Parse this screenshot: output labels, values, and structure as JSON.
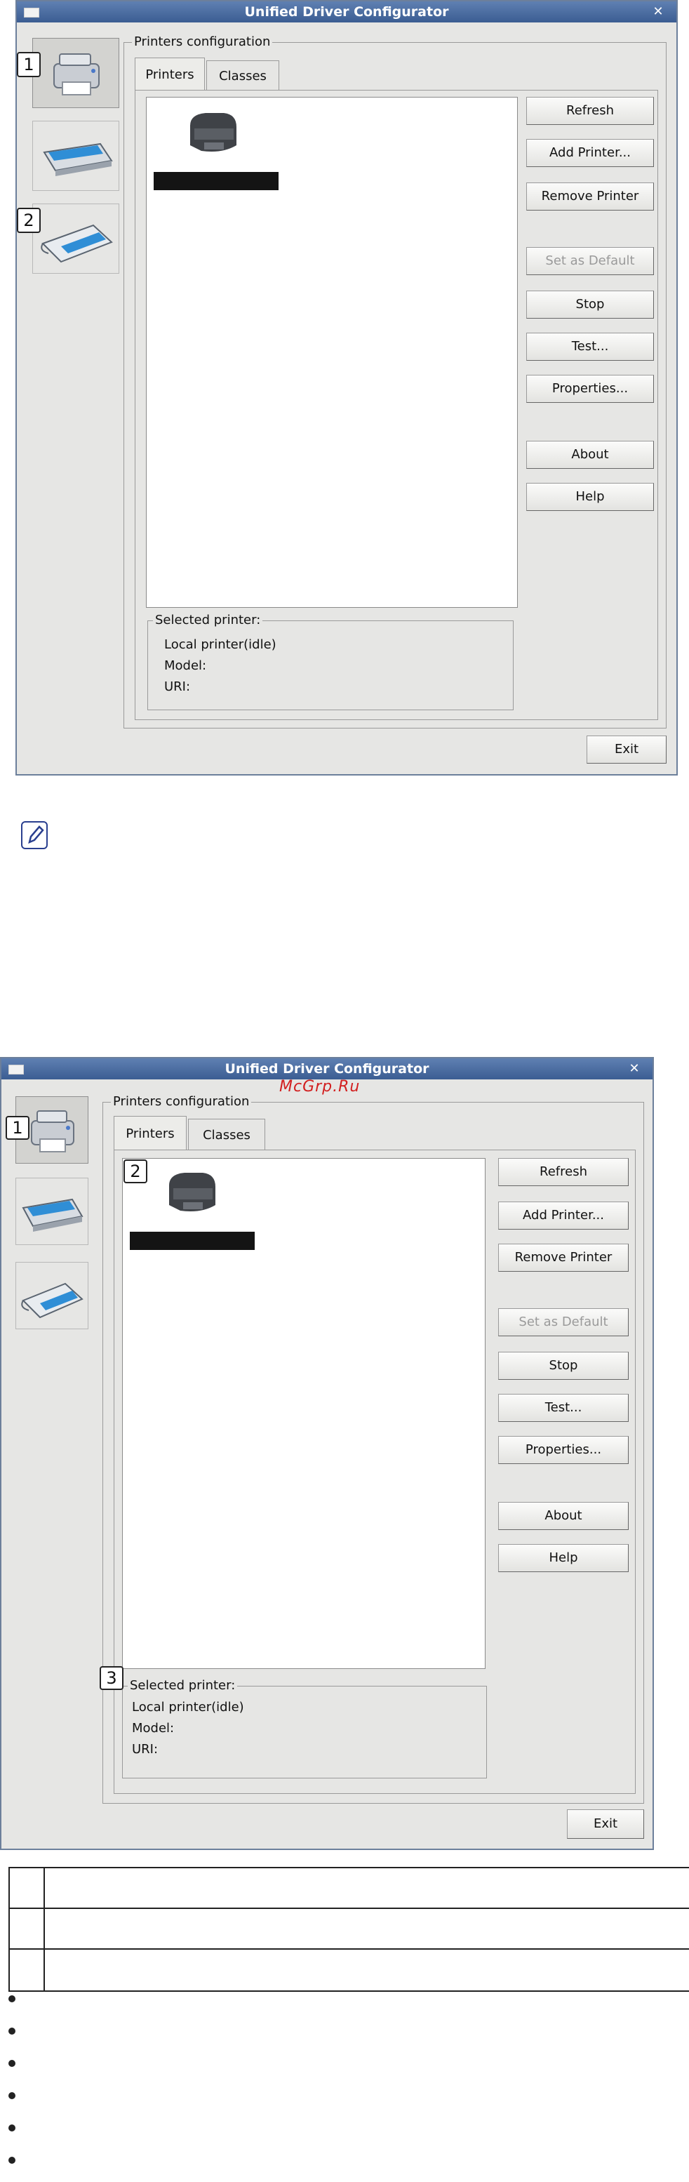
{
  "screens": [
    {
      "title": "Unified Driver Configurator",
      "close_label": "✕",
      "group_title": "Printers configuration",
      "tabs": [
        "Printers",
        "Classes"
      ],
      "buttons": {
        "refresh": "Refresh",
        "add_printer": "Add Printer...",
        "remove_printer": "Remove Printer",
        "set_default": "Set as Default",
        "stop": "Stop",
        "test": "Test...",
        "properties": "Properties...",
        "about": "About",
        "help": "Help",
        "exit": "Exit"
      },
      "selected_printer": {
        "title": "Selected printer:",
        "status": "Local printer(idle)",
        "model": "Model:",
        "uri": "URI:"
      },
      "callouts": [
        "1",
        "2"
      ]
    },
    {
      "title": "Unified Driver Configurator",
      "close_label": "✕",
      "group_title": "Printers configuration",
      "tabs": [
        "Printers",
        "Classes"
      ],
      "buttons": {
        "refresh": "Refresh",
        "add_printer": "Add Printer...",
        "remove_printer": "Remove Printer",
        "set_default": "Set as Default",
        "stop": "Stop",
        "test": "Test...",
        "properties": "Properties...",
        "about": "About",
        "help": "Help",
        "exit": "Exit"
      },
      "selected_printer": {
        "title": "Selected printer:",
        "status": "Local printer(idle)",
        "model": "Model:",
        "uri": "URI:"
      },
      "callouts": [
        "1",
        "2",
        "3"
      ],
      "watermark": "McGrp.Ru"
    }
  ],
  "icons": {
    "note": "note-pencil-icon",
    "printer": "printer-icon",
    "scanner": "scanner-icon",
    "port": "port-icon"
  },
  "colors": {
    "titlebar": "#3b5d92",
    "watermark": "#d21f1f"
  }
}
